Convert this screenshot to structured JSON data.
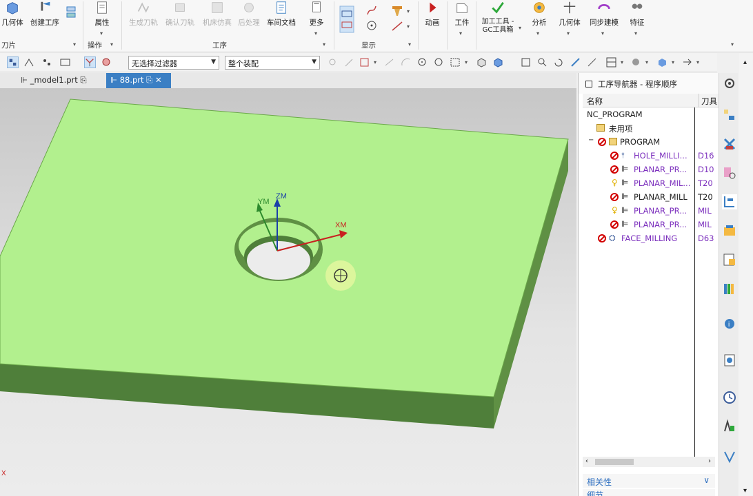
{
  "ribbon": {
    "buttons": {
      "geometry": "几何体",
      "create_op": "创建工序",
      "attributes": "属性",
      "gen_toolpath": "生成刀轨",
      "verify_toolpath": "确认刀轨",
      "machine_sim": "机床仿真",
      "postprocess": "后处理",
      "shop_doc": "车间文档",
      "more": "更多",
      "animation": "动画",
      "workpiece": "工件",
      "mfg_tools_1": "加工工具 -",
      "mfg_tools_2": "GC工具箱",
      "analysis": "分析",
      "geometry2": "几何体",
      "sync_model": "同步建模",
      "feature": "特征"
    },
    "groups": {
      "insert": "刀片",
      "operation": "操作",
      "process": "工序",
      "display": "显示"
    }
  },
  "toolbar": {
    "filter": "无选择过滤器",
    "assembly": "整个装配"
  },
  "tabs": [
    {
      "label": "_model1.prt"
    },
    {
      "label": "88.prt"
    }
  ],
  "viewport": {
    "axis_z": "ZM",
    "axis_y": "YM",
    "axis_x": "XM",
    "corner_x": "X"
  },
  "navigator": {
    "title": "工序导航器 - 程序顺序",
    "col_name": "名称",
    "col_tool": "刀具",
    "rows": [
      {
        "name": "NC_PROGRAM",
        "tool": ""
      },
      {
        "name": "未用项",
        "tool": ""
      },
      {
        "name": "PROGRAM",
        "tool": ""
      },
      {
        "name": "HOLE_MILLI...",
        "tool": "D16"
      },
      {
        "name": "PLANAR_PR...",
        "tool": "D10"
      },
      {
        "name": "PLANAR_MIL...",
        "tool": "T20"
      },
      {
        "name": "PLANAR_MILL",
        "tool": "T20"
      },
      {
        "name": "PLANAR_PR...",
        "tool": "MIL"
      },
      {
        "name": "PLANAR_PR...",
        "tool": "MIL"
      },
      {
        "name": "FACE_MILLING",
        "tool": "D63"
      }
    ],
    "related": "相关性",
    "details": "细节"
  },
  "colors": {
    "part_top": "#b2f08e",
    "part_side": "#4f7f3a",
    "accent": "#3b7fc4",
    "error": "#d20000",
    "op_purple": "#7b2fbd"
  }
}
